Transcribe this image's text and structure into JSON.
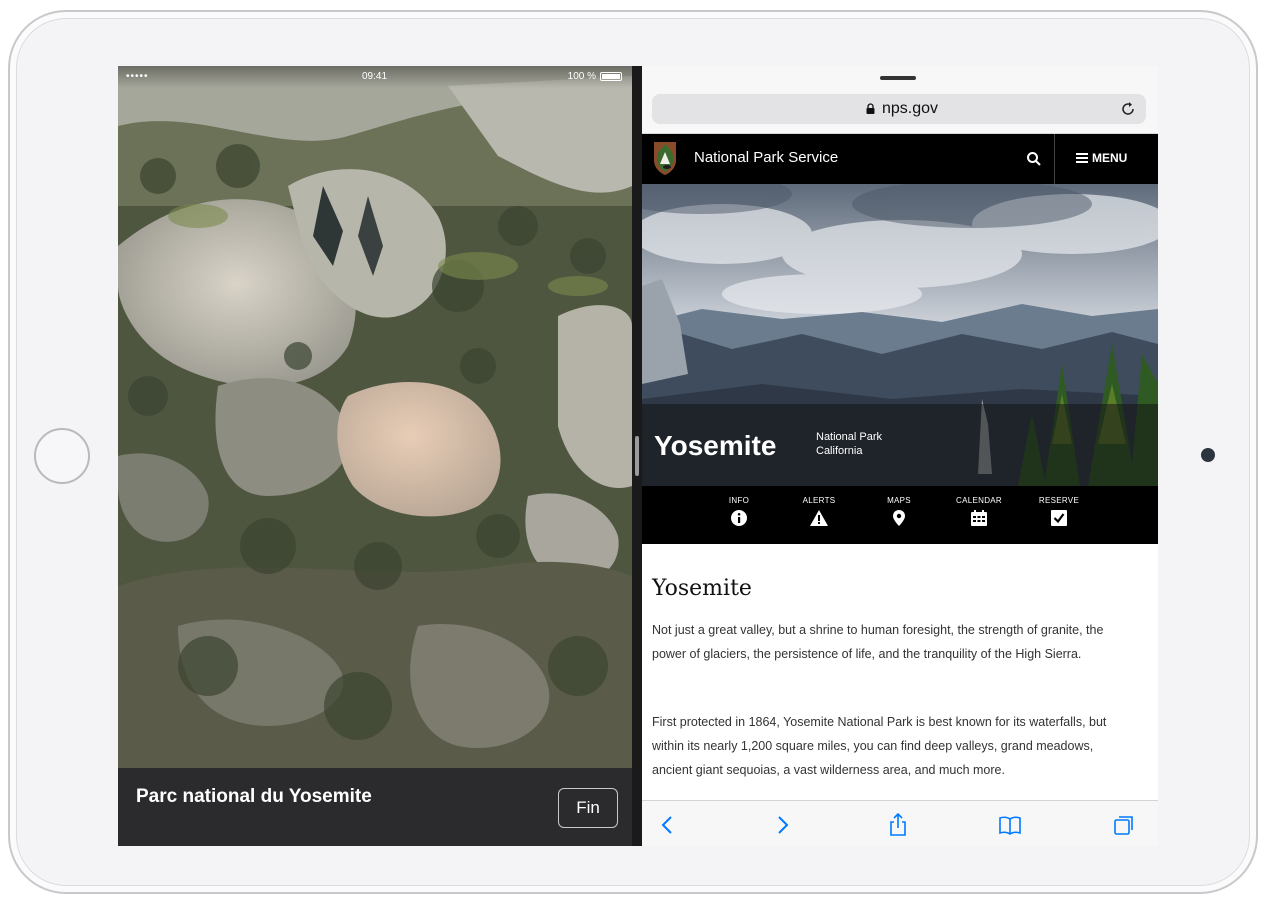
{
  "status_bar": {
    "signal": "•••••",
    "time": "09:41",
    "battery": "100 %"
  },
  "maps": {
    "place_title": "Parc national du Yosemite",
    "done_label": "Fin"
  },
  "safari": {
    "url": "nps.gov"
  },
  "nps": {
    "site_name": "National Park Service",
    "menu_label": "MENU"
  },
  "hero": {
    "title": "Yosemite",
    "subtitle_line1": "National Park",
    "subtitle_line2": "California"
  },
  "park_nav": [
    {
      "label": "INFO",
      "icon": "info-icon"
    },
    {
      "label": "ALERTS",
      "icon": "alert-icon"
    },
    {
      "label": "MAPS",
      "icon": "map-pin-icon"
    },
    {
      "label": "CALENDAR",
      "icon": "calendar-icon"
    },
    {
      "label": "RESERVE",
      "icon": "checkbox-icon"
    }
  ],
  "article": {
    "heading": "Yosemite",
    "paragraph1": "Not just a great valley, but a shrine to human foresight, the strength of granite, the power of glaciers, the persistence of life, and the tranquility of the High Sierra.",
    "paragraph2": "First protected in 1864, Yosemite National Park is best known for its waterfalls, but within its nearly 1,200 square miles, you can find deep valleys, grand meadows, ancient giant sequoias, a vast wilderness area, and much more."
  },
  "colors": {
    "accent": "#007aff",
    "nps_header": "#000000",
    "maps_footer": "#2b2b2d"
  }
}
